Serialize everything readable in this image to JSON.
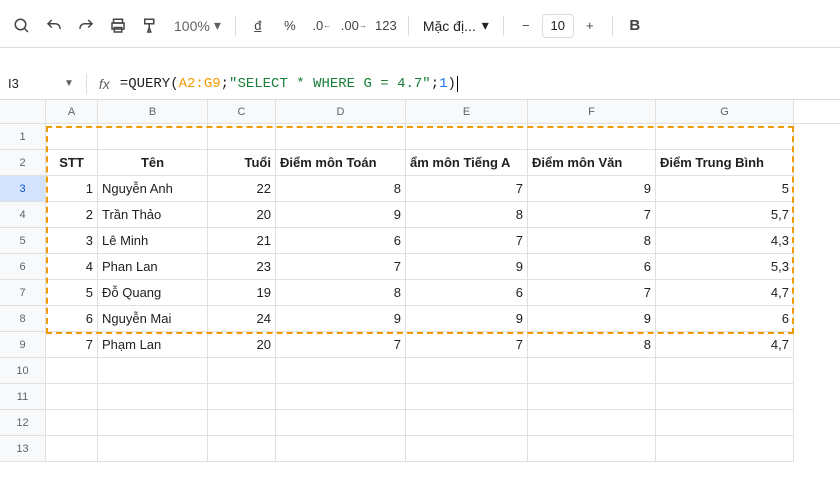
{
  "toolbar": {
    "zoom": "100%",
    "font": "Mặc đị...",
    "fontsize": "10"
  },
  "formula_bar": {
    "cell_ref": "I3",
    "fn": "=QUERY",
    "open": "(",
    "range": "A2:G9",
    "sep1": "; ",
    "query_str": "\"SELECT * WHERE G = 4.7\"",
    "sep2": "; ",
    "headers": "1",
    "close": ")"
  },
  "columns": [
    "A",
    "B",
    "C",
    "D",
    "E",
    "F",
    "G"
  ],
  "headers": {
    "stt": "STT",
    "ten": "Tên",
    "tuoi": "Tuổi",
    "toan": "Điểm môn Toán",
    "ta": "ẩm môn Tiếng A",
    "van": "Điểm môn Văn",
    "tb": "Điểm Trung Bình"
  },
  "rows": [
    {
      "stt": "1",
      "ten": "Nguyễn Anh",
      "tuoi": "22",
      "toan": "8",
      "ta": "7",
      "van": "9",
      "tb": "5"
    },
    {
      "stt": "2",
      "ten": "Trần Thảo",
      "tuoi": "20",
      "toan": "9",
      "ta": "8",
      "van": "7",
      "tb": "5,7"
    },
    {
      "stt": "3",
      "ten": "Lê Minh",
      "tuoi": "21",
      "toan": "6",
      "ta": "7",
      "van": "8",
      "tb": "4,3"
    },
    {
      "stt": "4",
      "ten": "Phan Lan",
      "tuoi": "23",
      "toan": "7",
      "ta": "9",
      "van": "6",
      "tb": "5,3"
    },
    {
      "stt": "5",
      "ten": "Đỗ Quang",
      "tuoi": "19",
      "toan": "8",
      "ta": "6",
      "van": "7",
      "tb": "4,7"
    },
    {
      "stt": "6",
      "ten": "Nguyễn Mai",
      "tuoi": "24",
      "toan": "9",
      "ta": "9",
      "van": "9",
      "tb": "6"
    },
    {
      "stt": "7",
      "ten": "Phạm Lan",
      "tuoi": "20",
      "toan": "7",
      "ta": "7",
      "van": "8",
      "tb": "4,7"
    }
  ],
  "chart_data": {
    "type": "table",
    "columns": [
      "STT",
      "Tên",
      "Tuổi",
      "Điểm môn Toán",
      "Điểm môn Tiếng Anh",
      "Điểm môn Văn",
      "Điểm Trung Bình"
    ],
    "rows": [
      [
        1,
        "Nguyễn Anh",
        22,
        8,
        7,
        9,
        5
      ],
      [
        2,
        "Trần Thảo",
        20,
        9,
        8,
        7,
        5.7
      ],
      [
        3,
        "Lê Minh",
        21,
        6,
        7,
        8,
        4.3
      ],
      [
        4,
        "Phan Lan",
        23,
        7,
        9,
        6,
        5.3
      ],
      [
        5,
        "Đỗ Quang",
        19,
        8,
        6,
        7,
        4.7
      ],
      [
        6,
        "Nguyễn Mai",
        24,
        9,
        9,
        9,
        6
      ],
      [
        7,
        "Phạm Lan",
        20,
        7,
        7,
        8,
        4.7
      ]
    ]
  }
}
